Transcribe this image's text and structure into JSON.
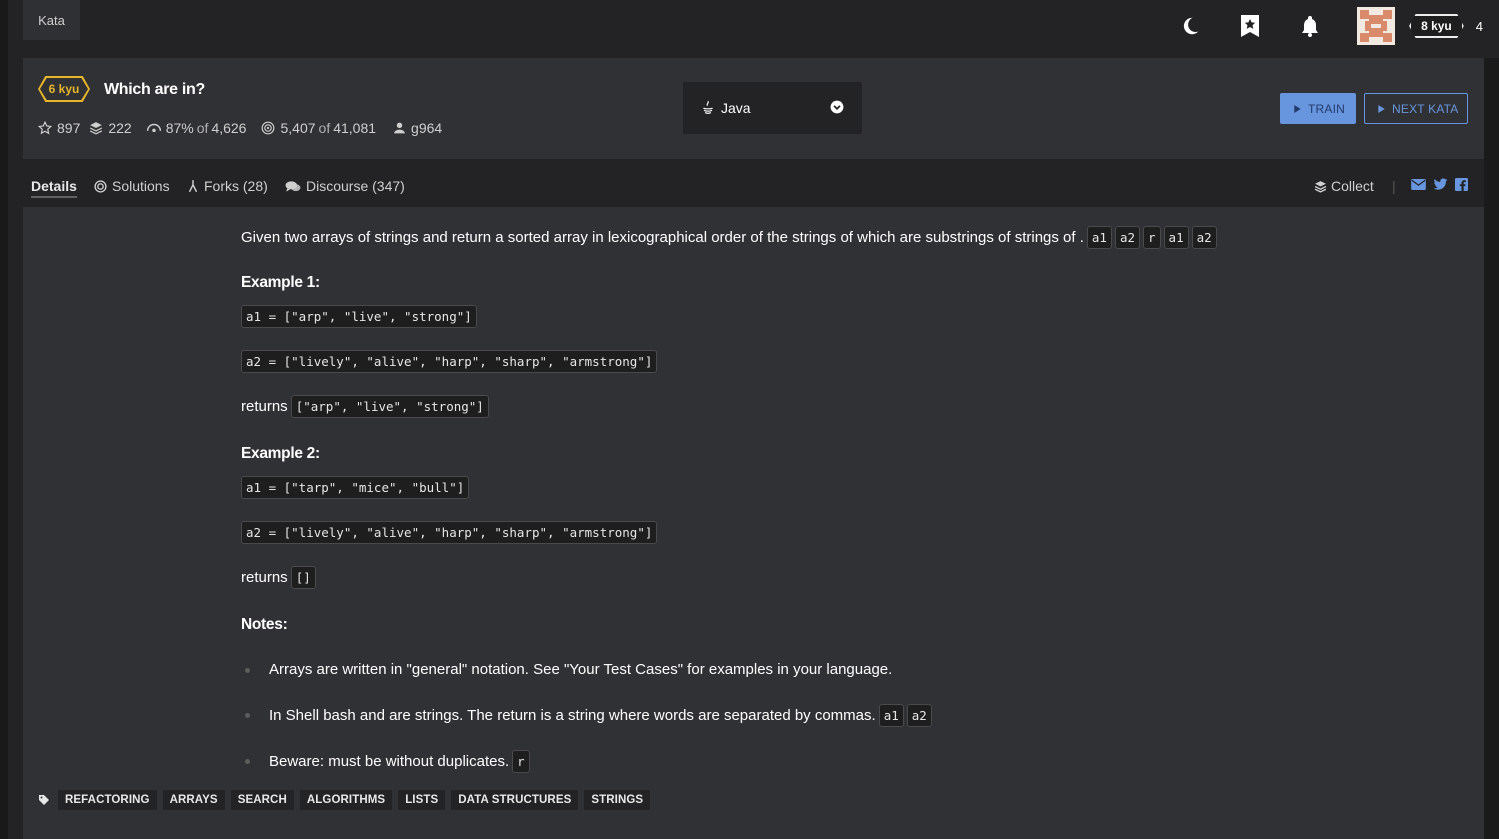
{
  "topbar": {
    "kata_tab": "Kata",
    "icons": [
      "moon-icon",
      "bookmark-star-icon",
      "bell-icon"
    ],
    "rank": "8 kyu",
    "honor": "4"
  },
  "header": {
    "kyu": "6 kyu",
    "title": "Which are in?",
    "stats": {
      "stars": "897",
      "collections": "222",
      "satisfaction": "87%",
      "of": "of",
      "votes": "4,626",
      "completed": "5,407",
      "attempts": "41,081",
      "author": "g964"
    },
    "language": "Java",
    "train_label": "TRAIN",
    "next_label": "NEXT KATA"
  },
  "tabs": {
    "details": "Details",
    "solutions": "Solutions",
    "forks": "Forks (28)",
    "discourse": "Discourse (347)",
    "collect": "Collect",
    "separator": "|"
  },
  "description": {
    "intro": "Given two arrays of strings and return a sorted array in lexicographical order of the strings of which are substrings of strings of .",
    "intro_codes": [
      "a1",
      "a2",
      "r",
      "a1",
      "a2"
    ],
    "example1_heading": "Example 1:",
    "ex1_a1": "a1 = [\"arp\", \"live\", \"strong\"]",
    "ex1_a2": "a2 = [\"lively\", \"alive\", \"harp\", \"sharp\", \"armstrong\"]",
    "returns_label": "returns",
    "ex1_returns": "[\"arp\", \"live\", \"strong\"]",
    "example2_heading": "Example 2:",
    "ex2_a1": "a1 = [\"tarp\", \"mice\", \"bull\"]",
    "ex2_a2": "a2 = [\"lively\", \"alive\", \"harp\", \"sharp\", \"armstrong\"]",
    "ex2_returns": "[]",
    "notes_heading": "Notes:",
    "note1": "Arrays are written in \"general\" notation. See \"Your Test Cases\" for examples in your language.",
    "note2": "In Shell bash and are strings. The return is a string where words are separated by commas.",
    "note2_codes": [
      "a1",
      "a2"
    ],
    "note3": "Beware: must be without duplicates.",
    "note3_code": "r"
  },
  "tags": [
    "REFACTORING",
    "ARRAYS",
    "SEARCH",
    "ALGORITHMS",
    "LISTS",
    "DATA STRUCTURES",
    "STRINGS"
  ],
  "colors": {
    "kyu_yellow": "#e6b52b",
    "accent_blue": "#6795de",
    "panel": "#303134",
    "dark": "#232325"
  }
}
